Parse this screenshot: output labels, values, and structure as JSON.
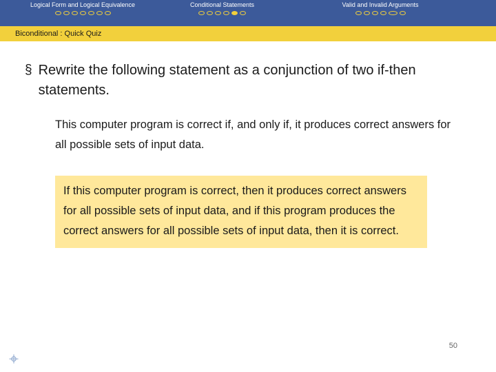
{
  "navbar": {
    "groups": [
      {
        "label": "Logical Form and Logical Equivalence",
        "dots": [
          {
            "state": "empty",
            "wide": false
          },
          {
            "state": "empty",
            "wide": false
          },
          {
            "state": "empty",
            "wide": false
          },
          {
            "state": "empty",
            "wide": false
          },
          {
            "state": "empty",
            "wide": false
          },
          {
            "state": "empty",
            "wide": false
          },
          {
            "state": "empty",
            "wide": false
          }
        ]
      },
      {
        "label": "Conditional Statements",
        "dots": [
          {
            "state": "empty",
            "wide": false
          },
          {
            "state": "empty",
            "wide": false
          },
          {
            "state": "empty",
            "wide": false
          },
          {
            "state": "empty",
            "wide": false
          },
          {
            "state": "filled",
            "wide": false
          },
          {
            "state": "empty",
            "wide": false
          }
        ]
      },
      {
        "label": "Valid and Invalid Arguments",
        "dots": [
          {
            "state": "empty",
            "wide": false
          },
          {
            "state": "empty",
            "wide": false
          },
          {
            "state": "empty",
            "wide": false
          },
          {
            "state": "empty",
            "wide": false
          },
          {
            "state": "empty",
            "wide": true
          },
          {
            "state": "empty",
            "wide": false
          }
        ]
      }
    ]
  },
  "subtitle": "Biconditional : Quick Quiz",
  "main": {
    "bullet_mark": "§",
    "bullet_text": "Rewrite the following statement as a conjunction of two if-then statements.",
    "statement": "This computer program is correct if, and only if, it produces correct answers for all possible sets of input data.",
    "answer": "If this computer program is correct, then it produces correct answers for all possible sets of input data, and if this program produces the correct answers for all possible sets of input data, then it is correct."
  },
  "footer": {
    "page_number": "50"
  },
  "colors": {
    "navbar": "#3c5a9a",
    "accent": "#f2d03c",
    "highlight": "#ffe89b"
  }
}
